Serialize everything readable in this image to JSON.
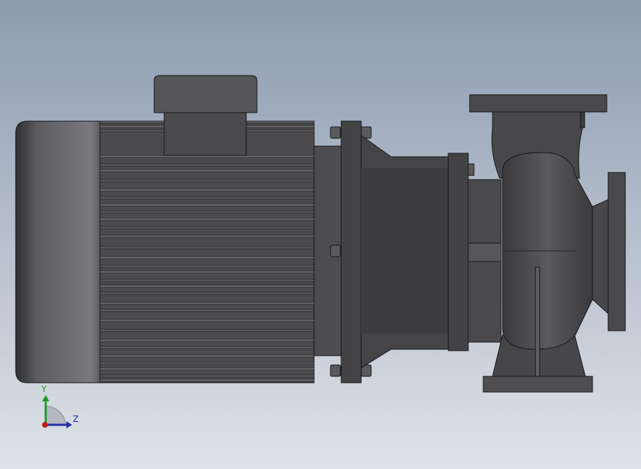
{
  "viewport": {
    "background_top": "#8c9bb0",
    "background_bottom": "#dfe2e8"
  },
  "model": {
    "name": "centrifugal-pump-motor-assembly",
    "body_color": "#4b4b4e",
    "shade_color": "#39393c",
    "highlight_color": "#6e6e72",
    "edge_color": "#151515"
  },
  "triad": {
    "y_label": "Y",
    "z_label": "Z",
    "y_color": "#1f9a2a",
    "z_color": "#1f2fa0",
    "x_color": "#c01818"
  }
}
